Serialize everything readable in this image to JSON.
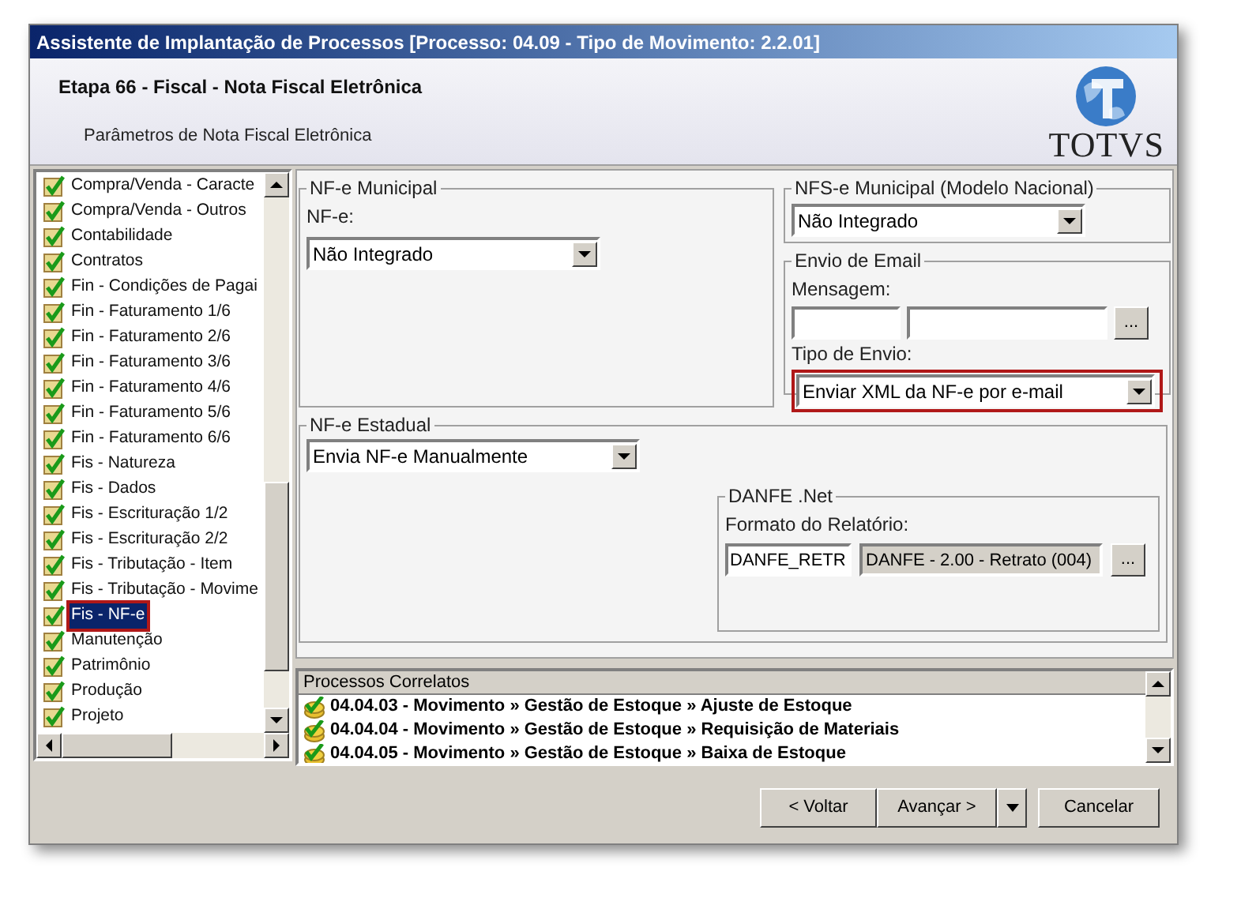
{
  "window": {
    "title": "Assistente de Implantação de Processos [Processo: 04.09 - Tipo de Movimento: 2.2.01]"
  },
  "header": {
    "step": "Etapa 66 - Fiscal - Nota Fiscal Eletrônica",
    "subtitle": "Parâmetros de Nota Fiscal Eletrônica",
    "logo_text": "TOTVS"
  },
  "sidebar": {
    "items": [
      {
        "label": "Compra/Venda - Caracte",
        "selected": false,
        "highlighted": false
      },
      {
        "label": "Compra/Venda - Outros",
        "selected": false,
        "highlighted": false
      },
      {
        "label": "Contabilidade",
        "selected": false,
        "highlighted": false
      },
      {
        "label": "Contratos",
        "selected": false,
        "highlighted": false
      },
      {
        "label": "Fin - Condições de Pagai",
        "selected": false,
        "highlighted": false
      },
      {
        "label": "Fin - Faturamento 1/6",
        "selected": false,
        "highlighted": false
      },
      {
        "label": "Fin - Faturamento 2/6",
        "selected": false,
        "highlighted": false
      },
      {
        "label": "Fin - Faturamento 3/6",
        "selected": false,
        "highlighted": false
      },
      {
        "label": "Fin - Faturamento 4/6",
        "selected": false,
        "highlighted": false
      },
      {
        "label": "Fin - Faturamento 5/6",
        "selected": false,
        "highlighted": false
      },
      {
        "label": "Fin - Faturamento 6/6",
        "selected": false,
        "highlighted": false
      },
      {
        "label": "Fis - Natureza",
        "selected": false,
        "highlighted": false
      },
      {
        "label": "Fis - Dados",
        "selected": false,
        "highlighted": false
      },
      {
        "label": "Fis - Escrituração 1/2",
        "selected": false,
        "highlighted": false
      },
      {
        "label": "Fis - Escrituração 2/2",
        "selected": false,
        "highlighted": false
      },
      {
        "label": "Fis - Tributação - Item",
        "selected": false,
        "highlighted": false
      },
      {
        "label": "Fis - Tributação - Movime",
        "selected": false,
        "highlighted": false
      },
      {
        "label": "Fis - NF-e",
        "selected": true,
        "highlighted": true
      },
      {
        "label": "Manutenção",
        "selected": false,
        "highlighted": false
      },
      {
        "label": "Patrimônio",
        "selected": false,
        "highlighted": false
      },
      {
        "label": "Produção",
        "selected": false,
        "highlighted": false
      },
      {
        "label": "Projeto",
        "selected": false,
        "highlighted": false
      }
    ]
  },
  "nfe_municipal": {
    "legend": "NF-e Municipal",
    "label": "NF-e:",
    "value": "Não Integrado"
  },
  "nfse_municipal": {
    "legend": "NFS-e Municipal (Modelo Nacional)",
    "value": "Não Integrado"
  },
  "envio_email": {
    "legend": "Envio de Email",
    "message_label": "Mensagem:",
    "button": "...",
    "type_label": "Tipo de Envio:",
    "type_value": "Enviar XML da NF-e por e-mail",
    "highlighted": true
  },
  "nfe_estadual": {
    "legend": "NF-e Estadual",
    "value": "Envia NF-e Manualmente"
  },
  "danfe": {
    "legend": "DANFE .Net",
    "label": "Formato do Relatório:",
    "code": "DANFE_RETR",
    "description": "DANFE - 2.00 - Retrato (004)",
    "button": "..."
  },
  "related": {
    "header": "Processos Correlatos",
    "rows": [
      "04.04.03 - Movimento » Gestão de Estoque » Ajuste de Estoque",
      "04.04.04 - Movimento » Gestão de Estoque » Requisição de Materiais",
      "04.04.05 - Movimento » Gestão de Estoque » Baixa de Estoque"
    ]
  },
  "buttons": {
    "back": "< Voltar",
    "next": "Avançar >",
    "cancel": "Cancelar"
  }
}
